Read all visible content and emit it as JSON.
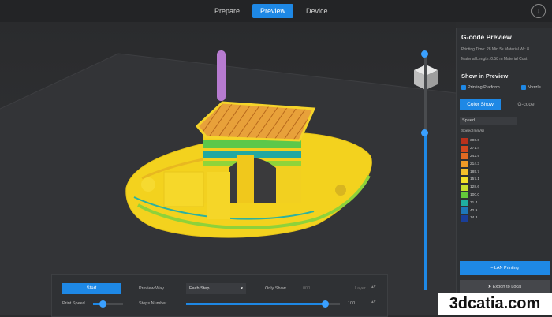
{
  "tabs": [
    {
      "label": "Prepare",
      "active": false
    },
    {
      "label": "Preview",
      "active": true
    },
    {
      "label": "Device",
      "active": false
    }
  ],
  "top_icon": "download-icon",
  "panel": {
    "title": "G-code Preview",
    "info_line1": "Printing Time: 28 Min 5s   Material Wt: 8",
    "info_line2": "Material Length: 0.58 m   Material Cost",
    "show_title": "Show in Preview",
    "check_platform": "Printing Platform",
    "check_nozzle": "Nozzle",
    "tab_color": "Color Show",
    "tab_gcode": "G-code",
    "select_value": "Speed",
    "legend_title": "Speed(mm/s)",
    "legend": [
      {
        "value": "300.0",
        "color": "#b8311c"
      },
      {
        "value": "271.4",
        "color": "#d2481e"
      },
      {
        "value": "242.9",
        "color": "#e06a22"
      },
      {
        "value": "214.3",
        "color": "#f09a26"
      },
      {
        "value": "185.7",
        "color": "#f5c02a"
      },
      {
        "value": "157.1",
        "color": "#f2e028"
      },
      {
        "value": "128.6",
        "color": "#c6e02c"
      },
      {
        "value": "100.0",
        "color": "#63c83a"
      },
      {
        "value": "71.4",
        "color": "#1fb0a0"
      },
      {
        "value": "42.9",
        "color": "#1e78b8"
      },
      {
        "value": "14.3",
        "color": "#1a3f9a"
      }
    ],
    "btn_wifi": "LAN Printing",
    "btn_export": "Export to Local"
  },
  "bottom": {
    "start": "Start",
    "preview_way_label": "Preview Way",
    "preview_way_value": "Each Step",
    "only_show": "Only Show",
    "only_show_value": "000",
    "layer": "Layer",
    "print_speed": "Print Speed",
    "steps_number": "Steps Number",
    "steps_value": "100",
    "steps_progress": 0.9
  },
  "watermark": "3dcatia.com"
}
